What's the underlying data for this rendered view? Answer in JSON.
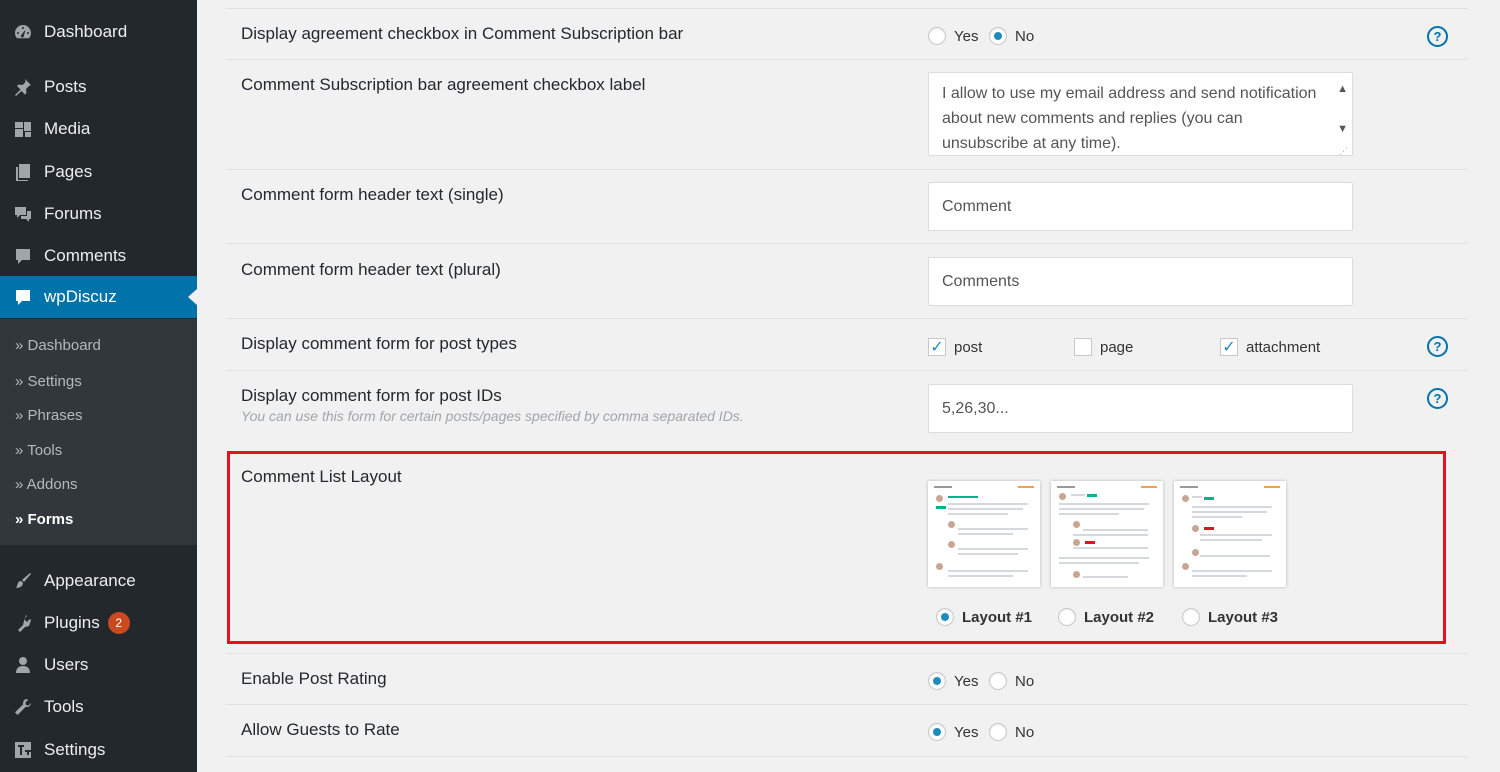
{
  "sidebar": {
    "items": [
      {
        "label": "Dashboard",
        "icon": "dashboard-icon"
      },
      {
        "label": "Posts",
        "icon": "pin-icon"
      },
      {
        "label": "Media",
        "icon": "media-icon"
      },
      {
        "label": "Pages",
        "icon": "pages-icon"
      },
      {
        "label": "Forums",
        "icon": "forums-icon"
      },
      {
        "label": "Comments",
        "icon": "comment-icon"
      },
      {
        "label": "wpDiscuz",
        "icon": "comment-icon"
      },
      {
        "label": "Appearance",
        "icon": "brush-icon"
      },
      {
        "label": "Plugins",
        "icon": "plugin-icon",
        "badge": "2"
      },
      {
        "label": "Users",
        "icon": "user-icon"
      },
      {
        "label": "Tools",
        "icon": "wrench-icon"
      },
      {
        "label": "Settings",
        "icon": "settings-icon"
      }
    ],
    "submenu": [
      "» Dashboard",
      "» Settings",
      "» Phrases",
      "» Tools",
      "» Addons",
      "» Forms"
    ]
  },
  "settings": {
    "agreement_checkbox": {
      "label": "Display agreement checkbox in Comment Subscription bar",
      "yes": "Yes",
      "no": "No",
      "selected": "No"
    },
    "agreement_label": {
      "label": "Comment Subscription bar agreement checkbox label",
      "value": "I allow to use my email address and send notification about new comments and replies (you can unsubscribe at any time)."
    },
    "header_single": {
      "label": "Comment form header text (single)",
      "value": "Comment"
    },
    "header_plural": {
      "label": "Comment form header text (plural)",
      "value": "Comments"
    },
    "post_types": {
      "label": "Display comment form for post types",
      "options": [
        {
          "label": "post",
          "checked": true
        },
        {
          "label": "page",
          "checked": false
        },
        {
          "label": "attachment",
          "checked": true
        }
      ]
    },
    "post_ids": {
      "label": "Display comment form for post IDs",
      "hint": "You can use this form for certain posts/pages specified by comma separated IDs.",
      "placeholder": "5,26,30..."
    },
    "comment_list_layout": {
      "label": "Comment List Layout",
      "options": [
        "Layout #1",
        "Layout #2",
        "Layout #3"
      ],
      "selected": "Layout #1"
    },
    "post_rating": {
      "label": "Enable Post Rating",
      "yes": "Yes",
      "no": "No",
      "selected": "Yes"
    },
    "guests_rate": {
      "label": "Allow Guests to Rate",
      "yes": "Yes",
      "no": "No",
      "selected": "Yes"
    }
  },
  "help_icon": "?",
  "colors": {
    "admin_bar": "#23282d",
    "accent": "#0073aa",
    "highlight_border": "#e3111e",
    "badge": "#ca4a1f"
  }
}
